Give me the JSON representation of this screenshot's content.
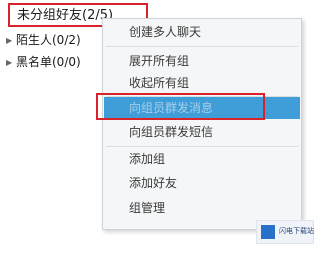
{
  "contacts_tree": {
    "groups": [
      {
        "label": "未分组好友(2/5)"
      },
      {
        "label": "陌生人(0/2)"
      },
      {
        "label": "黑名单(0/0)"
      }
    ]
  },
  "context_menu": {
    "items": [
      {
        "label": "创建多人聊天"
      },
      {
        "label": "展开所有组"
      },
      {
        "label": "收起所有组"
      },
      {
        "label": "向组员群发消息"
      },
      {
        "label": "向组员群发短信"
      },
      {
        "label": "添加组"
      },
      {
        "label": "添加好友"
      },
      {
        "label": "组管理"
      }
    ],
    "highlighted_index": 3,
    "accent_color": "#3f9ed8",
    "callout_color": "#d9232a"
  },
  "watermark": {
    "text": "闪电下载站"
  }
}
